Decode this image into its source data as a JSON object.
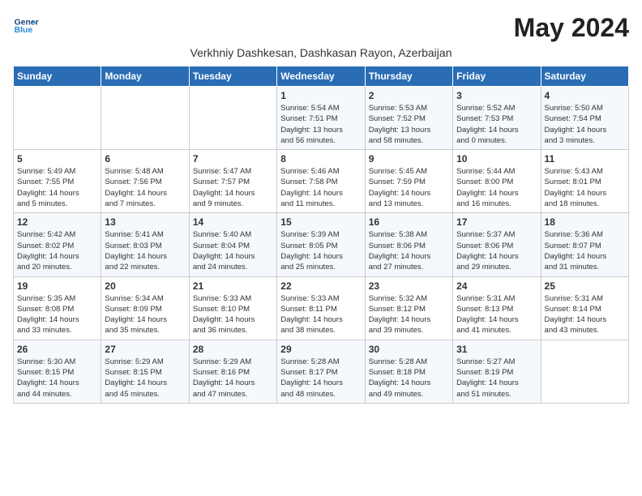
{
  "header": {
    "logo_line1": "General",
    "logo_line2": "Blue",
    "month_title": "May 2024",
    "subtitle": "Verkhniy Dashkesan, Dashkasan Rayon, Azerbaijan"
  },
  "weekdays": [
    "Sunday",
    "Monday",
    "Tuesday",
    "Wednesday",
    "Thursday",
    "Friday",
    "Saturday"
  ],
  "weeks": [
    [
      {
        "day": "",
        "info": ""
      },
      {
        "day": "",
        "info": ""
      },
      {
        "day": "",
        "info": ""
      },
      {
        "day": "1",
        "info": "Sunrise: 5:54 AM\nSunset: 7:51 PM\nDaylight: 13 hours\nand 56 minutes."
      },
      {
        "day": "2",
        "info": "Sunrise: 5:53 AM\nSunset: 7:52 PM\nDaylight: 13 hours\nand 58 minutes."
      },
      {
        "day": "3",
        "info": "Sunrise: 5:52 AM\nSunset: 7:53 PM\nDaylight: 14 hours\nand 0 minutes."
      },
      {
        "day": "4",
        "info": "Sunrise: 5:50 AM\nSunset: 7:54 PM\nDaylight: 14 hours\nand 3 minutes."
      }
    ],
    [
      {
        "day": "5",
        "info": "Sunrise: 5:49 AM\nSunset: 7:55 PM\nDaylight: 14 hours\nand 5 minutes."
      },
      {
        "day": "6",
        "info": "Sunrise: 5:48 AM\nSunset: 7:56 PM\nDaylight: 14 hours\nand 7 minutes."
      },
      {
        "day": "7",
        "info": "Sunrise: 5:47 AM\nSunset: 7:57 PM\nDaylight: 14 hours\nand 9 minutes."
      },
      {
        "day": "8",
        "info": "Sunrise: 5:46 AM\nSunset: 7:58 PM\nDaylight: 14 hours\nand 11 minutes."
      },
      {
        "day": "9",
        "info": "Sunrise: 5:45 AM\nSunset: 7:59 PM\nDaylight: 14 hours\nand 13 minutes."
      },
      {
        "day": "10",
        "info": "Sunrise: 5:44 AM\nSunset: 8:00 PM\nDaylight: 14 hours\nand 16 minutes."
      },
      {
        "day": "11",
        "info": "Sunrise: 5:43 AM\nSunset: 8:01 PM\nDaylight: 14 hours\nand 18 minutes."
      }
    ],
    [
      {
        "day": "12",
        "info": "Sunrise: 5:42 AM\nSunset: 8:02 PM\nDaylight: 14 hours\nand 20 minutes."
      },
      {
        "day": "13",
        "info": "Sunrise: 5:41 AM\nSunset: 8:03 PM\nDaylight: 14 hours\nand 22 minutes."
      },
      {
        "day": "14",
        "info": "Sunrise: 5:40 AM\nSunset: 8:04 PM\nDaylight: 14 hours\nand 24 minutes."
      },
      {
        "day": "15",
        "info": "Sunrise: 5:39 AM\nSunset: 8:05 PM\nDaylight: 14 hours\nand 25 minutes."
      },
      {
        "day": "16",
        "info": "Sunrise: 5:38 AM\nSunset: 8:06 PM\nDaylight: 14 hours\nand 27 minutes."
      },
      {
        "day": "17",
        "info": "Sunrise: 5:37 AM\nSunset: 8:06 PM\nDaylight: 14 hours\nand 29 minutes."
      },
      {
        "day": "18",
        "info": "Sunrise: 5:36 AM\nSunset: 8:07 PM\nDaylight: 14 hours\nand 31 minutes."
      }
    ],
    [
      {
        "day": "19",
        "info": "Sunrise: 5:35 AM\nSunset: 8:08 PM\nDaylight: 14 hours\nand 33 minutes."
      },
      {
        "day": "20",
        "info": "Sunrise: 5:34 AM\nSunset: 8:09 PM\nDaylight: 14 hours\nand 35 minutes."
      },
      {
        "day": "21",
        "info": "Sunrise: 5:33 AM\nSunset: 8:10 PM\nDaylight: 14 hours\nand 36 minutes."
      },
      {
        "day": "22",
        "info": "Sunrise: 5:33 AM\nSunset: 8:11 PM\nDaylight: 14 hours\nand 38 minutes."
      },
      {
        "day": "23",
        "info": "Sunrise: 5:32 AM\nSunset: 8:12 PM\nDaylight: 14 hours\nand 39 minutes."
      },
      {
        "day": "24",
        "info": "Sunrise: 5:31 AM\nSunset: 8:13 PM\nDaylight: 14 hours\nand 41 minutes."
      },
      {
        "day": "25",
        "info": "Sunrise: 5:31 AM\nSunset: 8:14 PM\nDaylight: 14 hours\nand 43 minutes."
      }
    ],
    [
      {
        "day": "26",
        "info": "Sunrise: 5:30 AM\nSunset: 8:15 PM\nDaylight: 14 hours\nand 44 minutes."
      },
      {
        "day": "27",
        "info": "Sunrise: 5:29 AM\nSunset: 8:15 PM\nDaylight: 14 hours\nand 45 minutes."
      },
      {
        "day": "28",
        "info": "Sunrise: 5:29 AM\nSunset: 8:16 PM\nDaylight: 14 hours\nand 47 minutes."
      },
      {
        "day": "29",
        "info": "Sunrise: 5:28 AM\nSunset: 8:17 PM\nDaylight: 14 hours\nand 48 minutes."
      },
      {
        "day": "30",
        "info": "Sunrise: 5:28 AM\nSunset: 8:18 PM\nDaylight: 14 hours\nand 49 minutes."
      },
      {
        "day": "31",
        "info": "Sunrise: 5:27 AM\nSunset: 8:19 PM\nDaylight: 14 hours\nand 51 minutes."
      },
      {
        "day": "",
        "info": ""
      }
    ]
  ]
}
